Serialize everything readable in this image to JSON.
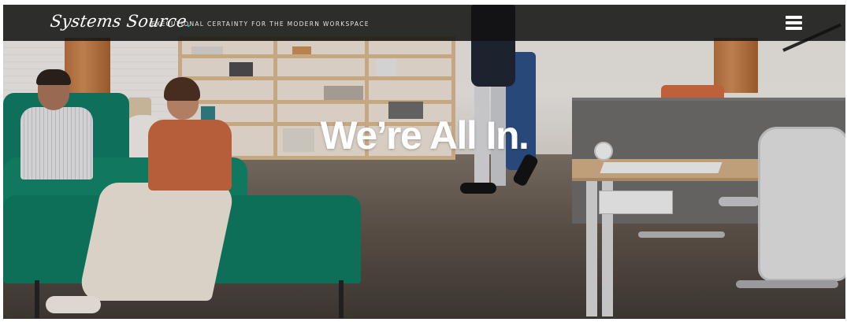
{
  "header": {
    "logo_text": "Systems Source",
    "logo_mark": ".",
    "tagline": "EXECUTIONAL CERTAINTY FOR THE MODERN WORKSPACE",
    "menu_icon": "hamburger-menu-icon"
  },
  "hero": {
    "headline": "We’re All In."
  },
  "colors": {
    "header_bg": "#121212",
    "logo_accent": "#2bb3c0",
    "headline": "#ffffff"
  }
}
